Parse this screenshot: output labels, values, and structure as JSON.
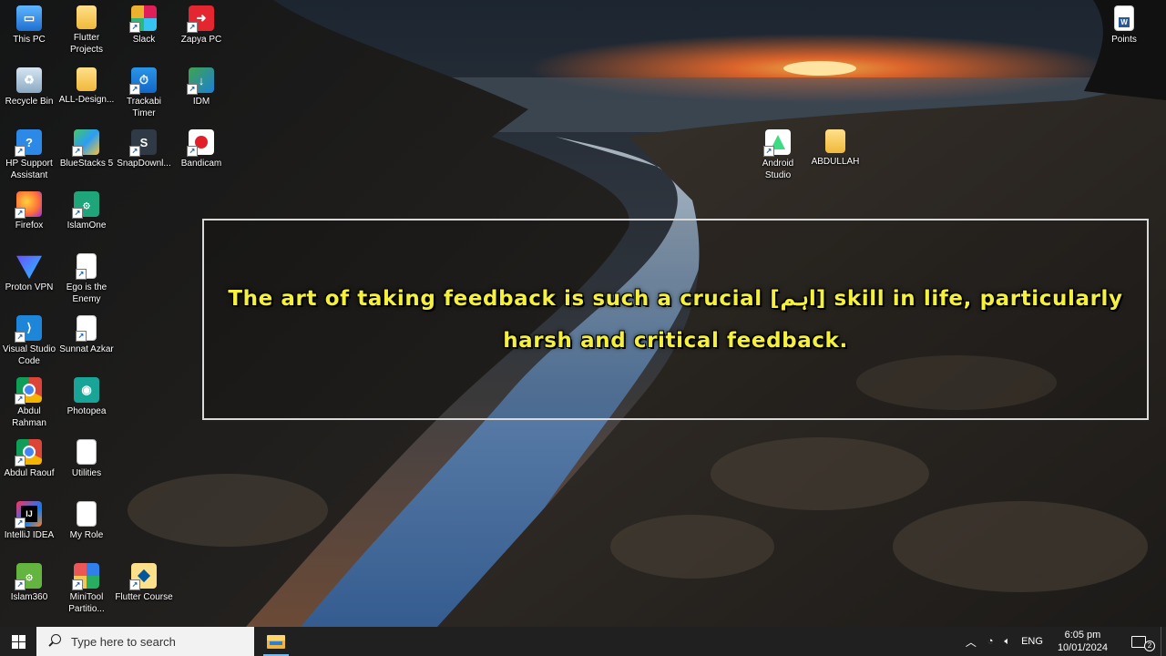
{
  "desktop": {
    "icons_col1": [
      {
        "label": "This PC",
        "icon": "computer-icon"
      },
      {
        "label": "Recycle Bin",
        "icon": "recycle-bin-icon"
      },
      {
        "label": "HP Support Assistant",
        "icon": "help-icon"
      },
      {
        "label": "Firefox",
        "icon": "firefox-icon"
      },
      {
        "label": "Proton VPN",
        "icon": "proton-vpn-icon"
      },
      {
        "label": "Visual Studio Code",
        "icon": "vscode-icon"
      },
      {
        "label": "Abdul Rahman",
        "icon": "chrome-profile-icon"
      },
      {
        "label": "Abdul Raouf",
        "icon": "chrome-profile-icon"
      },
      {
        "label": "IntelliJ IDEA",
        "icon": "intellij-icon"
      },
      {
        "label": "Islam360",
        "icon": "islam360-icon"
      }
    ],
    "icons_col2": [
      {
        "label": "Flutter Projects",
        "icon": "folder-icon"
      },
      {
        "label": "ALL-Design...",
        "icon": "folder-icon"
      },
      {
        "label": "BlueStacks 5",
        "icon": "bluestacks-icon"
      },
      {
        "label": "IslamOne",
        "icon": "islamone-icon"
      },
      {
        "label": "Ego is the Enemy",
        "icon": "pdf-icon"
      },
      {
        "label": "Sunnat Azkar",
        "icon": "pdf-icon"
      },
      {
        "label": "Photopea",
        "icon": "photopea-icon"
      },
      {
        "label": "Utilities",
        "icon": "text-file-icon"
      },
      {
        "label": "My Role",
        "icon": "text-file-icon"
      },
      {
        "label": "MiniTool Partitio...",
        "icon": "minitool-icon"
      }
    ],
    "icons_col3": [
      {
        "label": "Slack",
        "icon": "slack-icon"
      },
      {
        "label": "Trackabi Timer",
        "icon": "timer-icon"
      },
      {
        "label": "SnapDownl...",
        "icon": "snapdownloader-icon"
      },
      {
        "label": "Flutter Course",
        "icon": "flutter-folder-icon"
      }
    ],
    "icons_col4": [
      {
        "label": "Zapya PC",
        "icon": "zapya-icon"
      },
      {
        "label": "IDM",
        "icon": "idm-icon"
      },
      {
        "label": "Bandicam",
        "icon": "bandicam-icon"
      }
    ],
    "icons_misc": [
      {
        "label": "Android Studio",
        "icon": "android-studio-icon"
      },
      {
        "label": "ABDULLAH",
        "icon": "folder-icon"
      },
      {
        "label": "Points",
        "icon": "word-doc-icon"
      }
    ]
  },
  "caption": {
    "text": "The art of taking feedback is such a crucial [اہم] skill in life, particularly harsh and critical feedback."
  },
  "taskbar": {
    "search_placeholder": "Type here to search",
    "language": "ENG",
    "time": "6:05 pm",
    "date": "10/01/2024",
    "notification_count": "2"
  }
}
